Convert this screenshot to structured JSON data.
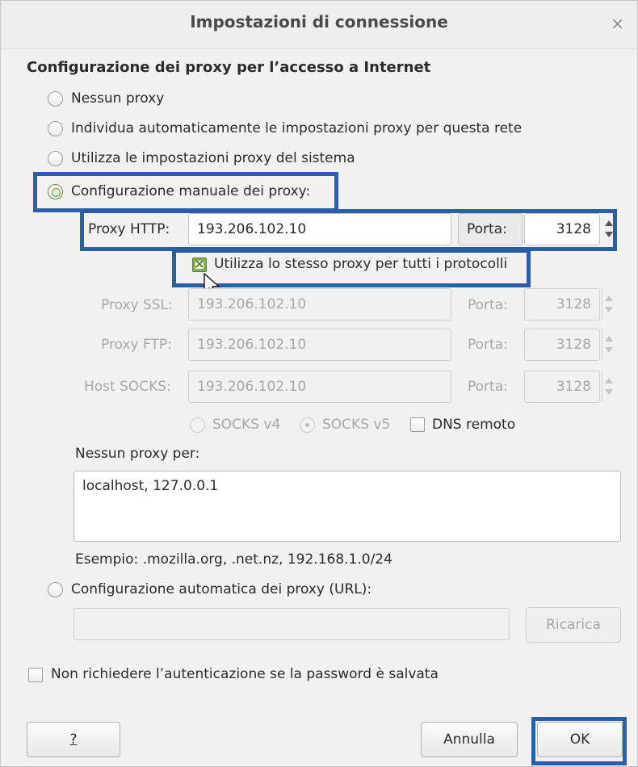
{
  "window": {
    "title": "Impostazioni di connessione",
    "close_glyph": "×"
  },
  "section_title": "Configurazione dei proxy per l’accesso a Internet",
  "radio_options": {
    "no_proxy": "Nessun proxy",
    "auto_detect": "Individua automaticamente le impostazioni proxy per questa rete",
    "system": "Utilizza le impostazioni proxy del sistema",
    "manual": "Configurazione manuale dei proxy:",
    "auto_url": "Configurazione automatica dei proxy (URL):"
  },
  "http": {
    "label": "Proxy HTTP:",
    "value": "193.206.102.10",
    "port_label": "Porta:",
    "port": "3128"
  },
  "same_proxy_label": "Utilizza lo stesso proxy per tutti i protocolli",
  "ssl": {
    "label": "Proxy SSL:",
    "value": "193.206.102.10",
    "port_label": "Porta:",
    "port": "3128"
  },
  "ftp": {
    "label": "Proxy FTP:",
    "value": "193.206.102.10",
    "port_label": "Porta:",
    "port": "3128"
  },
  "socks": {
    "label": "Host SOCKS:",
    "value": "193.206.102.10",
    "port_label": "Porta:",
    "port": "3128"
  },
  "socks_options": {
    "v4": "SOCKS v4",
    "v5": "SOCKS v5",
    "dns": "DNS remoto"
  },
  "no_proxy_for": {
    "label": "Nessun proxy per:",
    "value": "localhost, 127.0.0.1",
    "example": "Esempio: .mozilla.org, .net.nz, 192.168.1.0/24"
  },
  "auto_url": {
    "value": "",
    "reload_label": "Ricarica"
  },
  "no_auth_label": "Non richiedere l’autenticazione se la password è salvata",
  "buttons": {
    "help": "?",
    "cancel": "Annulla",
    "ok": "OK"
  },
  "colors": {
    "highlight": "#2b5ea8",
    "checked_green": "#7fae4f"
  },
  "state": {
    "selected_proxy_mode": "manual",
    "same_proxy_checked": true,
    "socks_version": "v5",
    "dns_remote_checked": false,
    "no_auth_checked": false
  }
}
